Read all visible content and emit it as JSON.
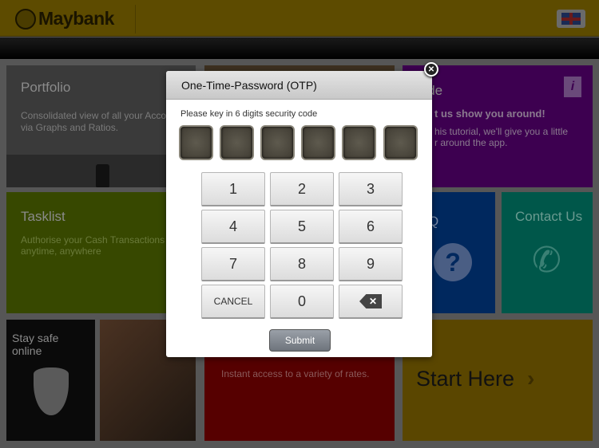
{
  "header": {
    "brand": "Maybank",
    "language_icon": "uk-flag-icon"
  },
  "tiles": {
    "portfolio": {
      "title": "Portfolio",
      "desc": "Consolidated view of all your Accou",
      "desc2": "via Graphs and Ratios.",
      "color": "#3a3a3a"
    },
    "guide": {
      "title": "uide",
      "subtitle": "t us show you around!",
      "desc": "his tutorial, we'll give you a little",
      "desc2": "r around the app.",
      "color": "#3d0050"
    },
    "tasklist": {
      "title": "Tasklist",
      "desc": "Authorise your Cash Transactions",
      "desc2": "anytime, anywhere",
      "color": "#374800"
    },
    "faq": {
      "title": "Q",
      "color": "#00285e"
    },
    "contact": {
      "title": "Contact Us",
      "color": "#00574a"
    },
    "staysafe": {
      "title": "Stay safe",
      "title2": "online",
      "color": "#0a0a0a"
    },
    "rates": {
      "desc": "Instant access to a variety of rates.",
      "color": "#560000"
    },
    "start": {
      "title": "Start Here",
      "color": "#5a4600"
    }
  },
  "dialog": {
    "title": "One-Time-Password (OTP)",
    "prompt": "Please key in 6 digits security code",
    "otp_length": 6,
    "keys": [
      "1",
      "2",
      "3",
      "4",
      "5",
      "6",
      "7",
      "8",
      "9",
      "CANCEL",
      "0"
    ],
    "submit": "Submit"
  }
}
